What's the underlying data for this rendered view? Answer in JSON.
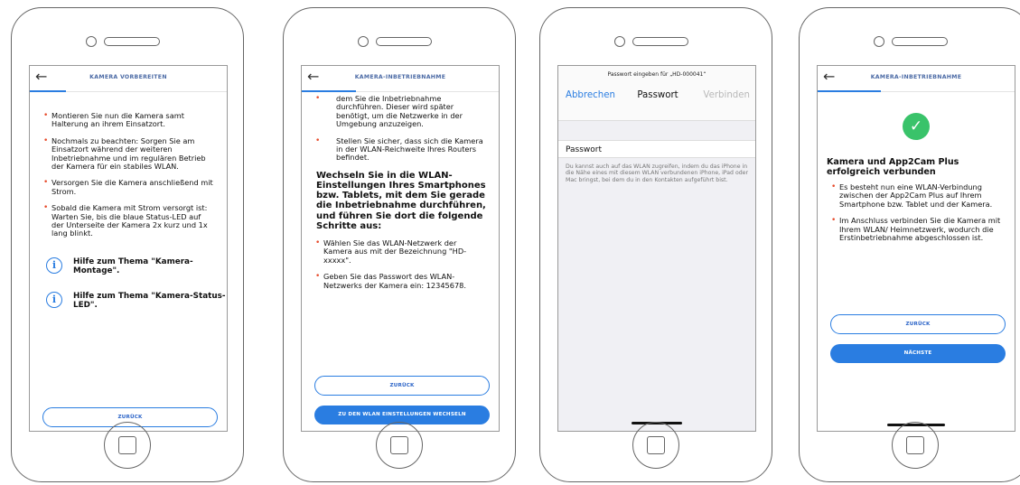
{
  "screen1": {
    "back": "←",
    "title": "KAMERA VORBEREITEN",
    "bullets": [
      "Montieren Sie nun die Kamera samt Halterung an ihrem Einsatzort.",
      "Nochmals zu beachten: Sorgen Sie am Einsatzort während der weiteren Inbetriebnahme und im regulären Betrieb der Kamera für ein stabiles WLAN.",
      "Versorgen Sie die Kamera anschließend mit Strom.",
      "Sobald die Kamera mit Strom versorgt ist: Warten Sie, bis die blaue Status-LED auf der Unterseite der Kamera 2x kurz und 1x lang blinkt."
    ],
    "help1": "Hilfe zum Thema \"Kamera-Montage\".",
    "help2": "Hilfe zum Thema \"Kamera-Status-LED\".",
    "info_glyph": "i",
    "back_button": "ZURÜCK"
  },
  "screen2": {
    "back": "←",
    "title": "KAMERA-INBETRIEBNAHME",
    "bullet1": "dem Sie die Inbetriebnahme durchführen. Dieser wird später benötigt, um die Netzwerke in der Umgebung anzuzeigen.",
    "bullet2": "Stellen Sie sicher, dass sich die Kamera in der WLAN-Reichweite Ihres Routers befindet.",
    "bold": "Wechseln Sie in die WLAN-Einstellungen Ihres Smartphones bzw. Tablets, mit dem Sie gerade die Inbetriebnahme durchführen, und führen Sie dort die folgende Schritte aus:",
    "bullet3": "Wählen Sie das WLAN-Netzwerk der Kamera aus mit der Bezeichnung \"HD-xxxxx\".",
    "bullet4": "Geben Sie das Passwort des WLAN-Netzwerks der Kamera ein: 12345678.",
    "back_button": "ZURÜCK",
    "primary_button": "ZU DEN WLAN EINSTELLUNGEN WECHSELN"
  },
  "screen3": {
    "prompt": "Passwort eingeben für „HD-000041“",
    "cancel": "Abbrechen",
    "title": "Passwort",
    "connect": "Verbinden",
    "field_label": "Passwort",
    "note": "Du kannst auch auf das WLAN zugreifen, indem du das iPhone in die Nähe eines mit diesem WLAN verbundenen iPhone, iPad oder Mac bringst, bei dem du in den Kontakten aufgeführt bist."
  },
  "screen4": {
    "back": "←",
    "title": "KAMERA-INBETRIEBNAHME",
    "check": "✓",
    "heading": "Kamera und App2Cam Plus erfolgreich verbunden",
    "bullets": [
      "Es besteht nun eine WLAN-Verbindung zwischen der App2Cam Plus auf Ihrem Smartphone bzw. Tablet und der Kamera.",
      "Im Anschluss verbinden Sie die Kamera mit Ihrem WLAN/ Heimnetzwerk, wodurch die Erstinbetriebnahme abgeschlossen ist."
    ],
    "back_button": "ZURÜCK",
    "next_button": "NÄCHSTE"
  }
}
